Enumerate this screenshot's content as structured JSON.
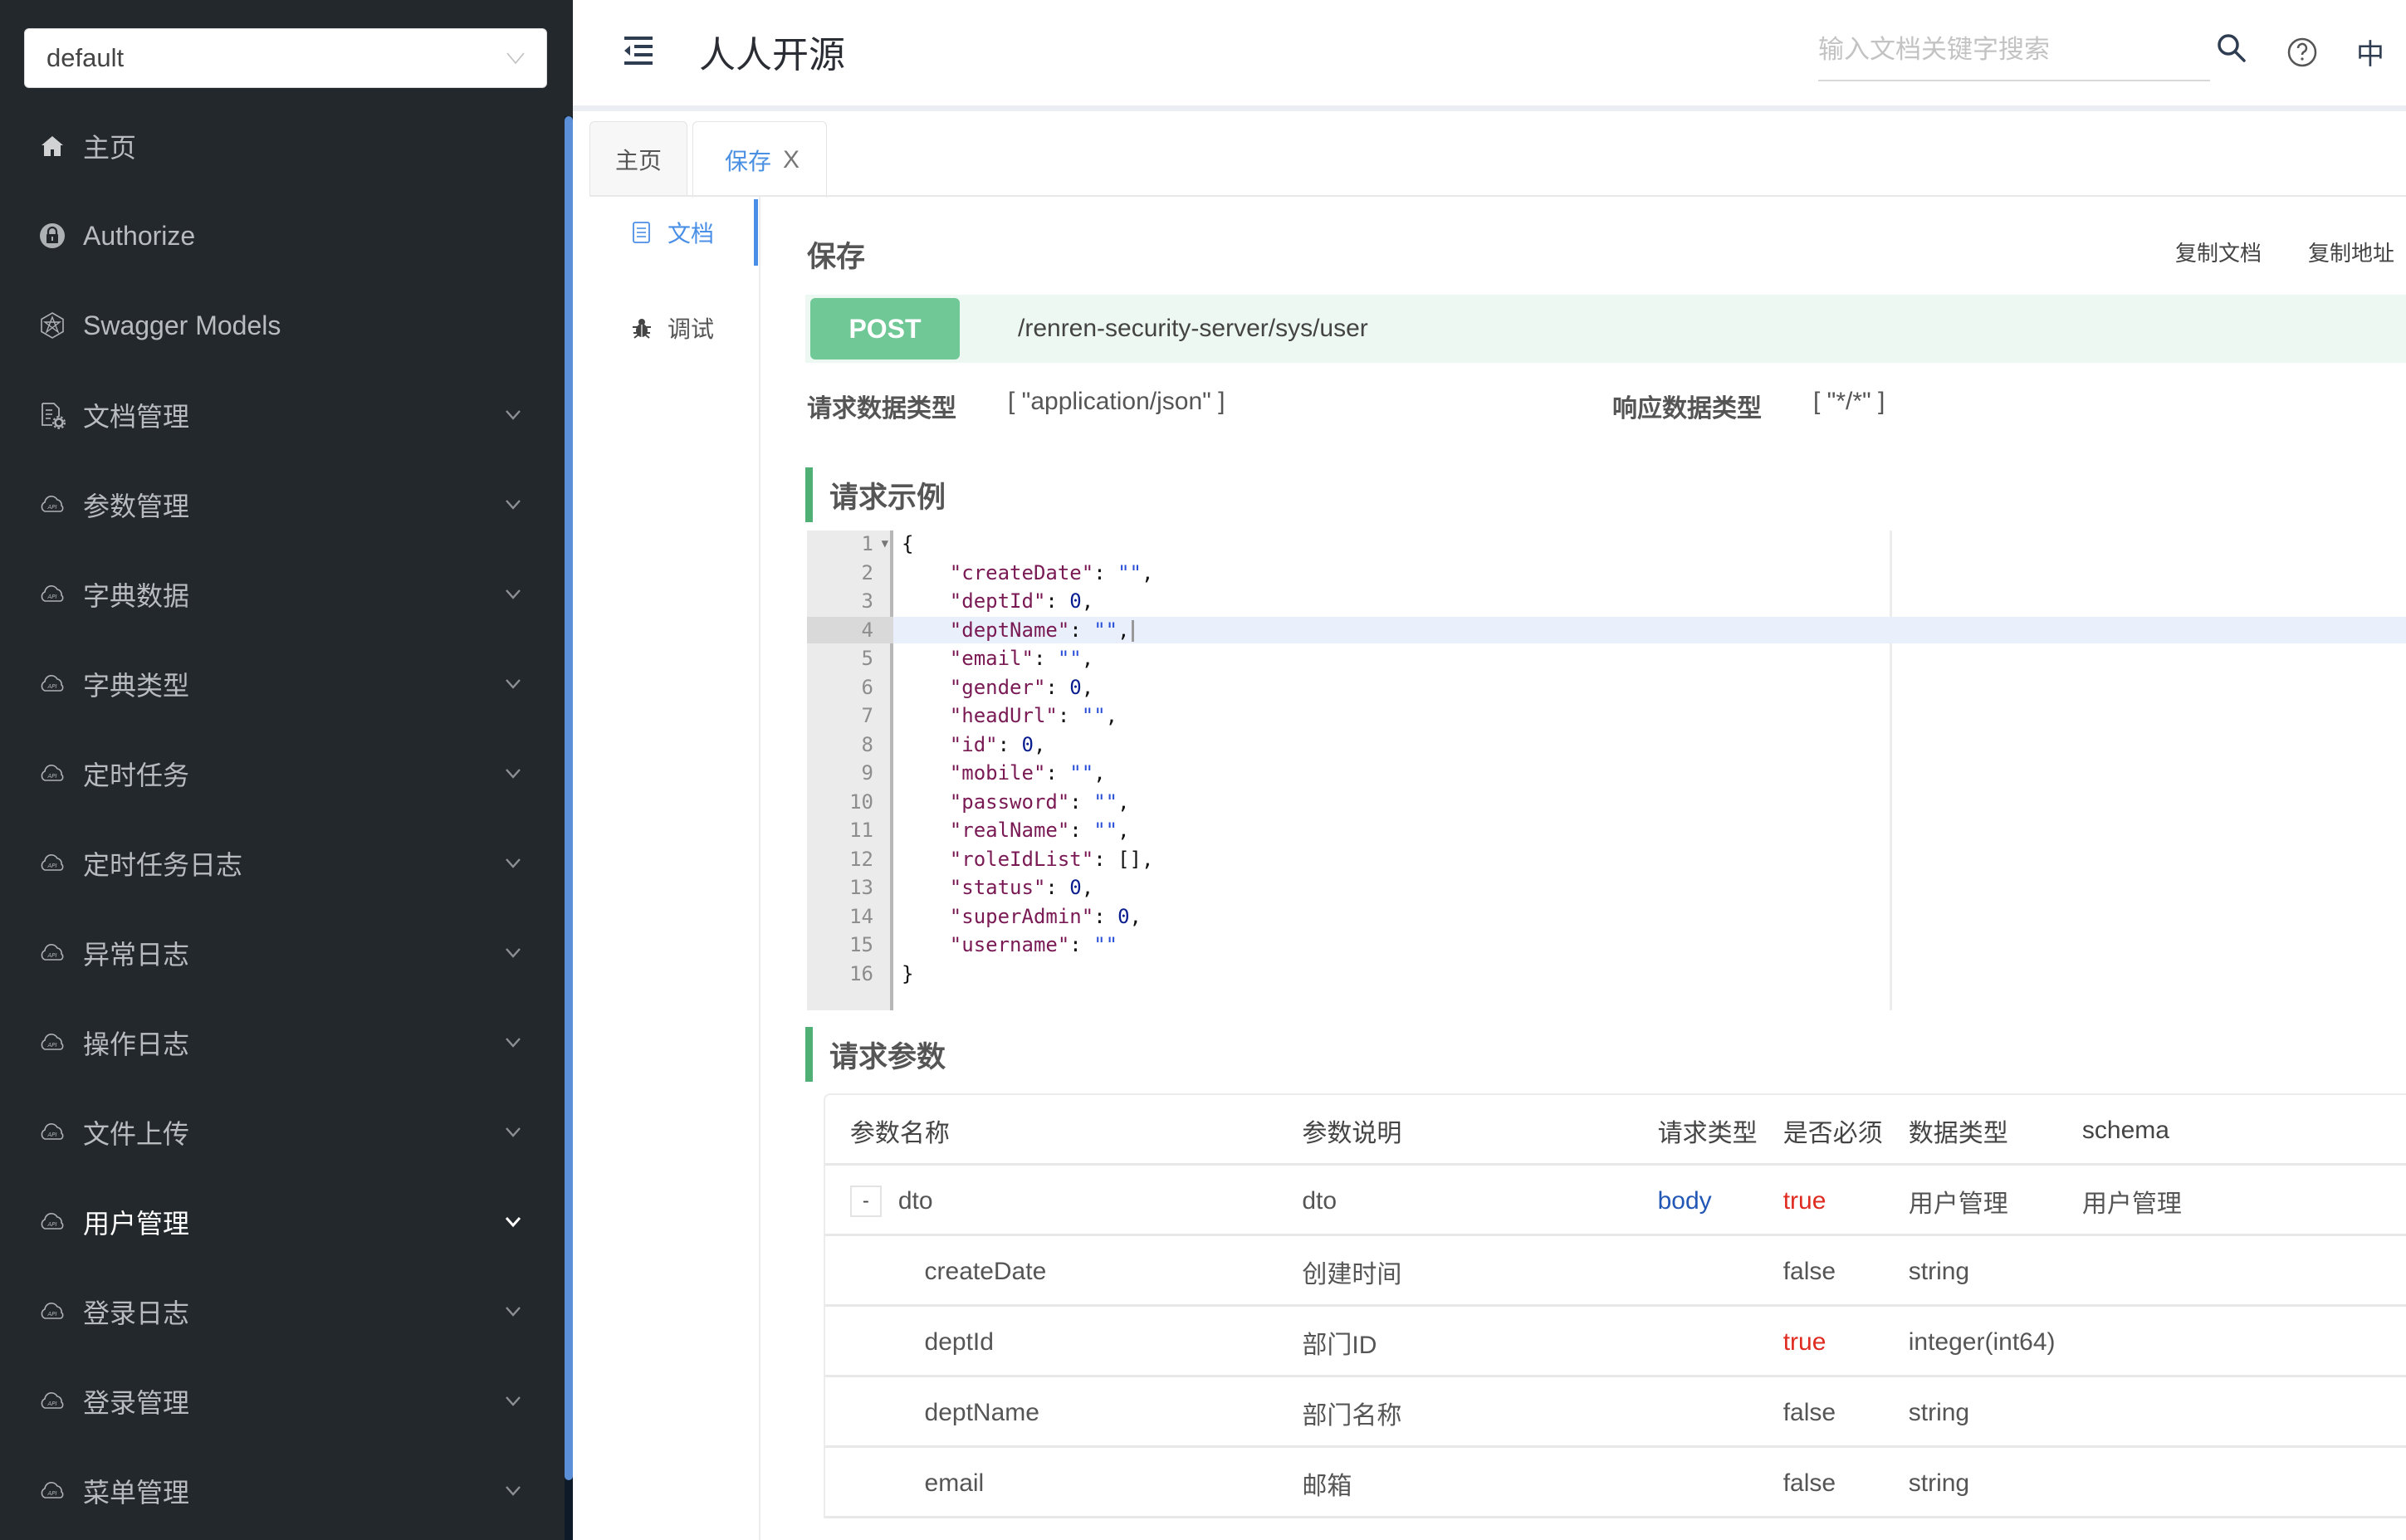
{
  "sidebar": {
    "group_select": {
      "value": "default"
    },
    "items": [
      {
        "label": "主页",
        "icon": "home-icon",
        "has_arrow": false,
        "active": false
      },
      {
        "label": "Authorize",
        "icon": "lock-icon",
        "has_arrow": false,
        "active": false
      },
      {
        "label": "Swagger Models",
        "icon": "swagger-models-icon",
        "has_arrow": false,
        "active": false
      },
      {
        "label": "文档管理",
        "icon": "doc-settings-icon",
        "has_arrow": true,
        "active": false
      },
      {
        "label": "参数管理",
        "icon": "api-cloud-icon",
        "has_arrow": true,
        "active": false
      },
      {
        "label": "字典数据",
        "icon": "api-cloud-icon",
        "has_arrow": true,
        "active": false
      },
      {
        "label": "字典类型",
        "icon": "api-cloud-icon",
        "has_arrow": true,
        "active": false
      },
      {
        "label": "定时任务",
        "icon": "api-cloud-icon",
        "has_arrow": true,
        "active": false
      },
      {
        "label": "定时任务日志",
        "icon": "api-cloud-icon",
        "has_arrow": true,
        "active": false
      },
      {
        "label": "异常日志",
        "icon": "api-cloud-icon",
        "has_arrow": true,
        "active": false
      },
      {
        "label": "操作日志",
        "icon": "api-cloud-icon",
        "has_arrow": true,
        "active": false
      },
      {
        "label": "文件上传",
        "icon": "api-cloud-icon",
        "has_arrow": true,
        "active": false
      },
      {
        "label": "用户管理",
        "icon": "api-cloud-icon",
        "has_arrow": true,
        "active": true
      },
      {
        "label": "登录日志",
        "icon": "api-cloud-icon",
        "has_arrow": true,
        "active": false
      },
      {
        "label": "登录管理",
        "icon": "api-cloud-icon",
        "has_arrow": true,
        "active": false
      },
      {
        "label": "菜单管理",
        "icon": "api-cloud-icon",
        "has_arrow": true,
        "active": false
      }
    ]
  },
  "header": {
    "title": "人人开源",
    "search_placeholder": "输入文档关键字搜索",
    "search_value": "",
    "lang_label": "中"
  },
  "tabs": [
    {
      "label": "主页",
      "active": false,
      "closable": false
    },
    {
      "label": "保存",
      "active": true,
      "closable": true,
      "close_glyph": "X"
    }
  ],
  "subnav": [
    {
      "label": "文档",
      "icon": "document-icon",
      "active": true
    },
    {
      "label": "调试",
      "icon": "bug-icon",
      "active": false
    }
  ],
  "doc": {
    "operation_title": "保存",
    "actions": {
      "copy_doc": "复制文档",
      "copy_url": "复制地址"
    },
    "method": "POST",
    "url": "/renren-security-server/sys/user",
    "request_type_label": "请求数据类型",
    "request_type_value": "[ \"application/json\" ]",
    "response_type_label": "响应数据类型",
    "response_type_value": "[ \"*/*\" ]",
    "example_title": "请求示例",
    "params_title": "请求参数"
  },
  "code_example": {
    "highlighted_line": 4,
    "lines": [
      {
        "n": "1",
        "fold": true,
        "key": "",
        "val": "",
        "type": "open",
        "text": "{"
      },
      {
        "n": "2",
        "key": "\"createDate\"",
        "val": "\"\"",
        "type": "str",
        "comma": true
      },
      {
        "n": "3",
        "key": "\"deptId\"",
        "val": "0",
        "type": "num",
        "comma": true
      },
      {
        "n": "4",
        "key": "\"deptName\"",
        "val": "\"\"",
        "type": "str",
        "comma": true
      },
      {
        "n": "5",
        "key": "\"email\"",
        "val": "\"\"",
        "type": "str",
        "comma": true
      },
      {
        "n": "6",
        "key": "\"gender\"",
        "val": "0",
        "type": "num",
        "comma": true
      },
      {
        "n": "7",
        "key": "\"headUrl\"",
        "val": "\"\"",
        "type": "str",
        "comma": true
      },
      {
        "n": "8",
        "key": "\"id\"",
        "val": "0",
        "type": "num",
        "comma": true
      },
      {
        "n": "9",
        "key": "\"mobile\"",
        "val": "\"\"",
        "type": "str",
        "comma": true
      },
      {
        "n": "10",
        "key": "\"password\"",
        "val": "\"\"",
        "type": "str",
        "comma": true
      },
      {
        "n": "11",
        "key": "\"realName\"",
        "val": "\"\"",
        "type": "str",
        "comma": true
      },
      {
        "n": "12",
        "key": "\"roleIdList\"",
        "val": "[]",
        "type": "plain",
        "comma": true
      },
      {
        "n": "13",
        "key": "\"status\"",
        "val": "0",
        "type": "num",
        "comma": true
      },
      {
        "n": "14",
        "key": "\"superAdmin\"",
        "val": "0",
        "type": "num",
        "comma": true
      },
      {
        "n": "15",
        "key": "\"username\"",
        "val": "\"\"",
        "type": "str",
        "comma": false
      },
      {
        "n": "16",
        "key": "",
        "val": "",
        "type": "close",
        "text": "}"
      }
    ]
  },
  "params_table": {
    "headers": [
      "参数名称",
      "参数说明",
      "请求类型",
      "是否必须",
      "数据类型",
      "schema"
    ],
    "rows": [
      {
        "name": "dto",
        "expand": "-",
        "desc": "dto",
        "in": "body",
        "required": "true",
        "type": "用户管理",
        "schema": "用户管理",
        "child": false
      },
      {
        "name": "createDate",
        "desc": "创建时间",
        "in": "",
        "required": "false",
        "type": "string",
        "schema": "",
        "child": true
      },
      {
        "name": "deptId",
        "desc": "部门ID",
        "in": "",
        "required": "true",
        "type": "integer(int64)",
        "schema": "",
        "child": true
      },
      {
        "name": "deptName",
        "desc": "部门名称",
        "in": "",
        "required": "false",
        "type": "string",
        "schema": "",
        "child": true
      },
      {
        "name": "email",
        "desc": "邮箱",
        "in": "",
        "required": "false",
        "type": "string",
        "schema": "",
        "child": true
      }
    ]
  },
  "colors": {
    "sidebar_bg": "#22282c",
    "accent_blue": "#4a8fe7",
    "post_green": "#6fc895",
    "section_bar_green": "#4faf74",
    "required_red": "#e02b20",
    "body_blue": "#2257b6"
  }
}
